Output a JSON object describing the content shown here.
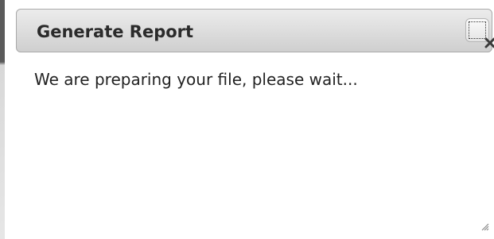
{
  "dialog": {
    "title": "Generate Report",
    "message": "We are preparing your file, please wait...",
    "close_button_icon": "close-icon",
    "resize_handle_icon": "resize-grip-icon"
  },
  "colors": {
    "titlebar_top": "#ececec",
    "titlebar_bottom": "#cfcfcf",
    "titlebar_border": "#a9a9a9",
    "title_text": "#2b2b2b",
    "body_text": "#222222",
    "background": "#ffffff"
  }
}
